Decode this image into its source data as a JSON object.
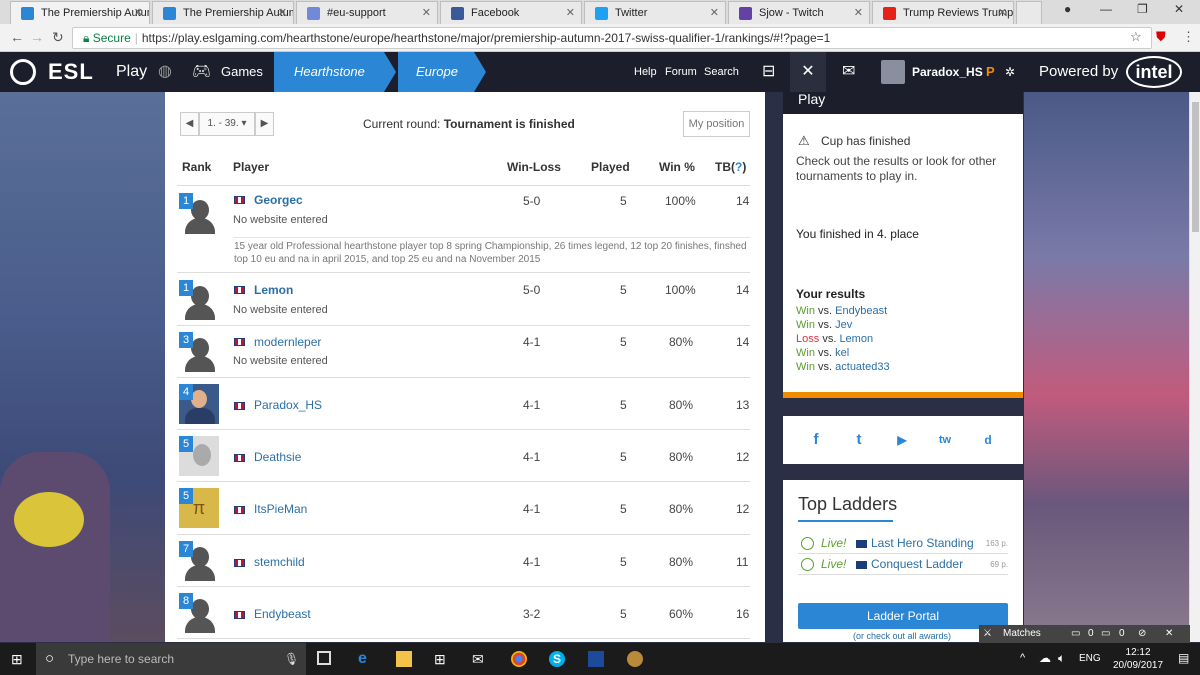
{
  "browser": {
    "tabs": [
      {
        "title": "The Premiership Autum",
        "color": "#2b86d6"
      },
      {
        "title": "The Premiership Autum",
        "color": "#2b86d6"
      },
      {
        "title": "#eu-support",
        "color": "#7289da"
      },
      {
        "title": "Facebook",
        "color": "#3b5998"
      },
      {
        "title": "Twitter",
        "color": "#1da1f2"
      },
      {
        "title": "Sjow - Twitch",
        "color": "#6441a4"
      },
      {
        "title": "Trump Reviews Trump",
        "color": "#e62117"
      }
    ],
    "secure_label": "Secure",
    "url": "https://play.eslgaming.com/hearthstone/europe/hearthstone/major/premiership-autumn-2017-swiss-qualifier-1/rankings/#!?page=1"
  },
  "nav": {
    "logo": "ESL",
    "play": "Play",
    "games": "Games",
    "crumb1": "Hearthstone",
    "crumb2": "Europe",
    "help": "Help",
    "forum": "Forum",
    "search": "Search",
    "username": "Paradox_HS",
    "powered": "Powered by",
    "intel": "intel"
  },
  "toolbar": {
    "pager_range": "1. - 39.",
    "pager_prev": "◀",
    "pager_next": "▶",
    "round_label": "Current round:",
    "round_value": "Tournament is finished",
    "my_position": "My position"
  },
  "table": {
    "headers": {
      "rank": "Rank",
      "player": "Player",
      "winloss": "Win-Loss",
      "played": "Played",
      "winpct": "Win %",
      "tb": "TB(",
      "tb_q": "?",
      "tb_close": ")"
    },
    "rows": [
      {
        "rank": "1",
        "name": "Georgec",
        "site": "No website entered",
        "wl": "5-0",
        "played": "5",
        "pct": "100%",
        "tb": "14",
        "bold": true
      },
      {
        "rank": "1",
        "name": "Lemon",
        "site": "No website entered",
        "wl": "5-0",
        "played": "5",
        "pct": "100%",
        "tb": "14",
        "bold": true
      },
      {
        "rank": "3",
        "name": "modernleper",
        "site": "No website entered",
        "wl": "4-1",
        "played": "5",
        "pct": "80%",
        "tb": "14",
        "bold": false
      },
      {
        "rank": "4",
        "name": "Paradox_HS",
        "site": "",
        "wl": "4-1",
        "played": "5",
        "pct": "80%",
        "tb": "13",
        "bold": false
      },
      {
        "rank": "5",
        "name": "Deathsie",
        "site": "",
        "wl": "4-1",
        "played": "5",
        "pct": "80%",
        "tb": "12",
        "bold": false
      },
      {
        "rank": "5",
        "name": "ItsPieMan",
        "site": "",
        "wl": "4-1",
        "played": "5",
        "pct": "80%",
        "tb": "12",
        "bold": false
      },
      {
        "rank": "7",
        "name": "stemchild",
        "site": "",
        "wl": "4-1",
        "played": "5",
        "pct": "80%",
        "tb": "11",
        "bold": false
      },
      {
        "rank": "8",
        "name": "Endybeast",
        "site": "",
        "wl": "3-2",
        "played": "5",
        "pct": "60%",
        "tb": "16",
        "bold": false
      }
    ],
    "bio": "15 year old Professional hearthstone player top 8 spring Championship, 26 times legend, 12 top 20 finishes, finshed top 10 eu and na in april 2015, and top 25 eu and na November 2015"
  },
  "sidebar": {
    "play_title": "Play",
    "cup_finished": "Cup has finished",
    "cup_text": "Check out the results or look for other tournaments to play in.",
    "finished": "You finished in 4. place",
    "results_title": "Your results",
    "vs": "vs.",
    "results": [
      {
        "outcome": "Win",
        "opponent": "Endybeast"
      },
      {
        "outcome": "Win",
        "opponent": "Jev"
      },
      {
        "outcome": "Loss",
        "opponent": "Lemon"
      },
      {
        "outcome": "Win",
        "opponent": "kel"
      },
      {
        "outcome": "Win",
        "opponent": "actuated33"
      }
    ],
    "social": [
      "f",
      "t",
      "▶",
      "tw",
      "d"
    ],
    "ladders_title": "Top Ladders",
    "ladders": [
      {
        "live": "Live!",
        "name": "Last Hero Standing",
        "pts": "163 p."
      },
      {
        "live": "Live!",
        "name": "Conquest Ladder",
        "pts": "69 p."
      }
    ],
    "ladder_portal": "Ladder Portal",
    "awards": "(or check out all awards)"
  },
  "widget": {
    "matches": "Matches",
    "count1": "0",
    "count2": "0"
  },
  "taskbar": {
    "search_placeholder": "Type here to search",
    "lang": "ENG",
    "time": "12:12",
    "date": "20/09/2017"
  }
}
